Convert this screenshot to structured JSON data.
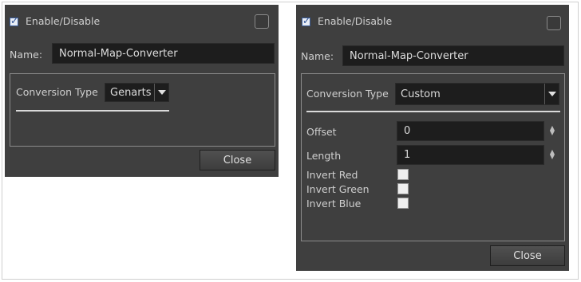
{
  "left_panel": {
    "enable_label": "Enable/Disable",
    "enable_checked": true,
    "name_label": "Name:",
    "name_value": "Normal-Map-Converter",
    "conversion_type_label": "Conversion Type",
    "conversion_type_value": "Genarts",
    "close_label": "Close"
  },
  "right_panel": {
    "enable_label": "Enable/Disable",
    "enable_checked": true,
    "name_label": "Name:",
    "name_value": "Normal-Map-Converter",
    "conversion_type_label": "Conversion Type",
    "conversion_type_value": "Custom",
    "offset_label": "Offset",
    "offset_value": "0",
    "length_label": "Length",
    "length_value": "1",
    "invert_red_label": "Invert Red",
    "invert_green_label": "Invert Green",
    "invert_blue_label": "Invert Blue",
    "close_label": "Close"
  }
}
